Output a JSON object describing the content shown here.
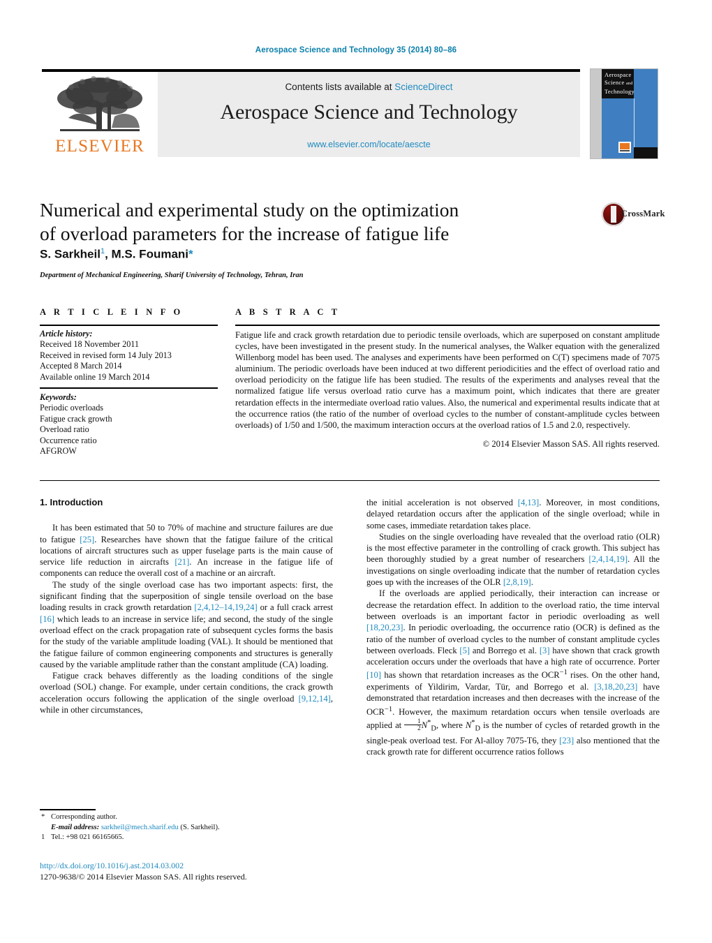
{
  "running_head": "Aerospace Science and Technology 35 (2014) 80–86",
  "masthead": {
    "contents_prefix": "Contents lists available at ",
    "sciencedirect": "ScienceDirect",
    "journal_title": "Aerospace Science and Technology",
    "url": "www.elsevier.com/locate/aescte",
    "publisher_logo_text": "ELSEVIER"
  },
  "cover": {
    "line1": "Aerospace",
    "line2": "Science",
    "line3": "and",
    "line4": "Technology"
  },
  "article": {
    "title_line1": "Numerical and experimental study on the optimization",
    "title_line2": "of overload parameters for the increase of fatigue life",
    "authors_part1": "S. Sarkheil",
    "authors_sup1": "1",
    "authors_part2": ", M.S. Foumani",
    "authors_star": "*",
    "affiliation": "Department of Mechanical Engineering, Sharif University of Technology, Tehran, Iran"
  },
  "crossmark": {
    "label": "CrossMark"
  },
  "article_info": {
    "heading": "A R T I C L E    I N F O",
    "history_label": "Article history:",
    "history": [
      "Received 18 November 2011",
      "Received in revised form 14 July 2013",
      "Accepted 8 March 2014",
      "Available online 19 March 2014"
    ],
    "keywords_label": "Keywords:",
    "keywords": [
      "Periodic overloads",
      "Fatigue crack growth",
      "Overload ratio",
      "Occurrence ratio",
      "AFGROW"
    ]
  },
  "abstract": {
    "heading": "A B S T R A C T",
    "text": "Fatigue life and crack growth retardation due to periodic tensile overloads, which are superposed on constant amplitude cycles, have been investigated in the present study. In the numerical analyses, the Walker equation with the generalized Willenborg model has been used. The analyses and experiments have been performed on C(T) specimens made of 7075 aluminium. The periodic overloads have been induced at two different periodicities and the effect of overload ratio and overload periodicity on the fatigue life has been studied. The results of the experiments and analyses reveal that the normalized fatigue life versus overload ratio curve has a maximum point, which indicates that there are greater retardation effects in the intermediate overload ratio values. Also, the numerical and experimental results indicate that at the occurrence ratios (the ratio of the number of overload cycles to the number of constant-amplitude cycles between overloads) of 1/50 and 1/500, the maximum interaction occurs at the overload ratios of 1.5 and 2.0, respectively.",
    "copyright": "© 2014 Elsevier Masson SAS. All rights reserved."
  },
  "body": {
    "section_heading": "1. Introduction",
    "left_paragraphs": [
      "It has been estimated that 50 to 70% of machine and structure failures are due to fatigue [25]. Researches have shown that the fatigue failure of the critical locations of aircraft structures such as upper fuselage parts is the main cause of service life reduction in aircrafts [21]. An increase in the fatigue life of components can reduce the overall cost of a machine or an aircraft.",
      "The study of the single overload case has two important aspects: first, the significant finding that the superposition of single tensile overload on the base loading results in crack growth retardation [2,4,12–14,19,24] or a full crack arrest [16] which leads to an increase in service life; and second, the study of the single overload effect on the crack propagation rate of subsequent cycles forms the basis for the study of the variable amplitude loading (VAL). It should be mentioned that the fatigue failure of common engineering components and structures is generally caused by the variable amplitude rather than the constant amplitude (CA) loading.",
      "Fatigue crack behaves differently as the loading conditions of the single overload (SOL) change. For example, under certain conditions, the crack growth acceleration occurs following the application of the single overload [9,12,14], while in other circumstances,"
    ],
    "right_paragraphs": [
      "the initial acceleration is not observed [4,13]. Moreover, in most conditions, delayed retardation occurs after the application of the single overload; while in some cases, immediate retardation takes place.",
      "Studies on the single overloading have revealed that the overload ratio (OLR) is the most effective parameter in the controlling of crack growth. This subject has been thoroughly studied by a great number of researchers [2,4,14,19]. All the investigations on single overloading indicate that the number of retardation cycles goes up with the increases of the OLR [2,8,19].",
      "If the overloads are applied periodically, their interaction can increase or decrease the retardation effect. In addition to the overload ratio, the time interval between overloads is an important factor in periodic overloading as well [18,20,23]. In periodic overloading, the occurrence ratio (OCR) is defined as the ratio of the number of overload cycles to the number of constant amplitude cycles between overloads. Fleck [5] and Borrego et al. [3] have shown that crack growth acceleration occurs under the overloads that have a high rate of occurrence. Porter [10] has shown that retardation increases as the OCR⁻¹ rises. On the other hand, experiments of Yildirim, Vardar, Tür, and Borrego et al. [3,18,20,23] have demonstrated that retardation increases and then decreases with the increase of the OCR⁻¹. However, the maximum retardation occurs when tensile overloads are applied at ½N*D, where N*D is the number of cycles of retarded growth in the single-peak overload test. For Al-alloy 7075-T6, they [23] also mentioned that the crack growth rate for different occurrence ratios follows"
    ]
  },
  "footnotes": {
    "corresponding_mark": "*",
    "corresponding_text": "Corresponding author.",
    "email_label": "E-mail address:",
    "email": "sarkheil@mech.sharif.edu",
    "email_owner": "(S. Sarkheil).",
    "tel_mark": "1",
    "tel_text": "Tel.: +98 021 66165665.",
    "doi": "http://dx.doi.org/10.1016/j.ast.2014.03.002",
    "issn_line": "1270-9638/© 2014 Elsevier Masson SAS. All rights reserved."
  },
  "colors": {
    "link": "#1f8ac0",
    "runhead": "#0b7fab",
    "elsevier_orange": "#e87722",
    "masthead_bg": "#ececec",
    "cover_blue": "#3f7fc1"
  }
}
